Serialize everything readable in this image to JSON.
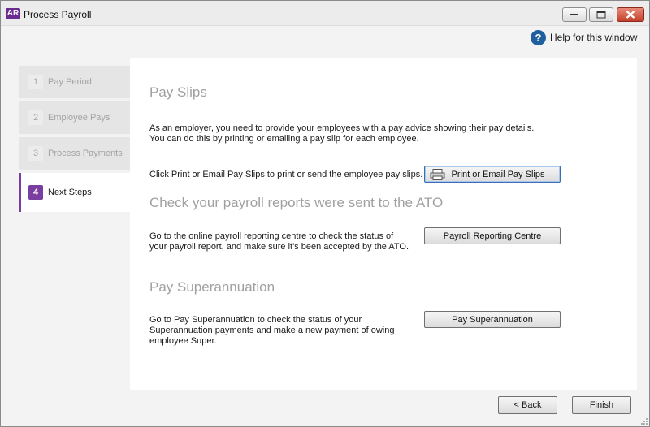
{
  "window": {
    "app_badge": "AR",
    "title": "Process Payroll"
  },
  "help": {
    "icon_glyph": "?",
    "label": "Help for this window"
  },
  "steps": [
    {
      "num": "1",
      "label": "Pay Period",
      "active": false
    },
    {
      "num": "2",
      "label": "Employee Pays",
      "active": false
    },
    {
      "num": "3",
      "label": "Process Payments",
      "active": false
    },
    {
      "num": "4",
      "label": "Next Steps",
      "active": true
    }
  ],
  "sections": {
    "pay_slips": {
      "title": "Pay Slips",
      "intro_line1": "As an employer, you need to provide your employees with a pay advice showing their pay details.",
      "intro_line2": "You can do this by printing or emailing a pay slip for each employee.",
      "instruction": "Click Print or Email Pay Slips to print or send the employee pay slips.",
      "button": "Print or Email Pay Slips"
    },
    "ato": {
      "title": "Check your payroll reports were sent to the ATO",
      "text_line1": "Go to the online payroll reporting centre to check the status of",
      "text_line2": "your payroll report, and make sure it's been accepted by the ATO.",
      "button": "Payroll Reporting Centre"
    },
    "super": {
      "title": "Pay Superannuation",
      "text_line1": "Go to Pay Superannuation to check the status of your",
      "text_line2": "Superannuation payments and make a new payment of owing",
      "text_line3": "employee Super.",
      "button": "Pay Superannuation"
    }
  },
  "footer": {
    "back": "< Back",
    "finish": "Finish"
  },
  "colors": {
    "accent": "#7a3ea0",
    "help_icon": "#1f5f9e",
    "section_title": "#a0a0a0"
  }
}
